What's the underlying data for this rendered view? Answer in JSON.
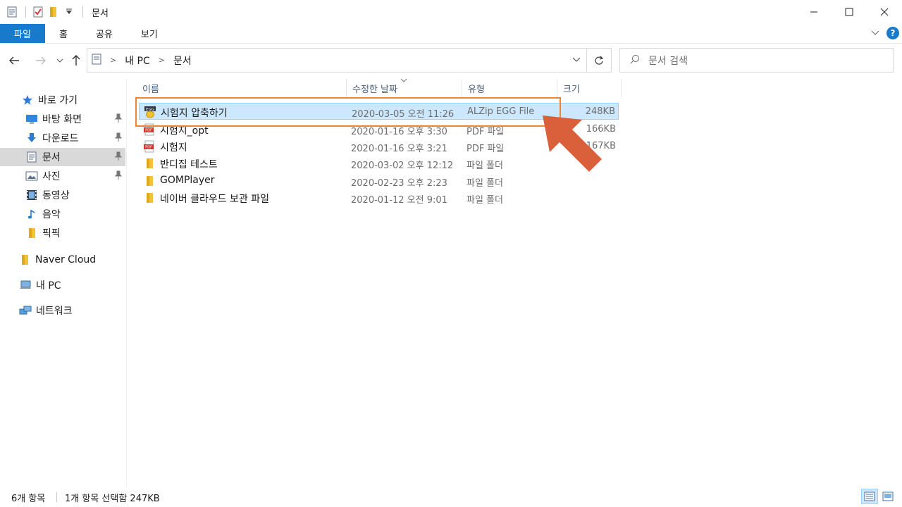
{
  "titlebar": {
    "title": "문서"
  },
  "ribbon": {
    "tabs": [
      "파일",
      "홈",
      "공유",
      "보기"
    ]
  },
  "address": {
    "crumbs": [
      "내 PC",
      "문서"
    ]
  },
  "search": {
    "placeholder": "문서 검색"
  },
  "sidebar": {
    "quick_access": "바로 가기",
    "pinned": [
      {
        "label": "바탕 화면",
        "icon": "desktop-icon"
      },
      {
        "label": "다운로드",
        "icon": "download-icon"
      },
      {
        "label": "문서",
        "icon": "documents-icon"
      },
      {
        "label": "사진",
        "icon": "pictures-icon"
      }
    ],
    "items": [
      {
        "label": "동영상",
        "icon": "videos-icon"
      },
      {
        "label": "음악",
        "icon": "music-icon"
      },
      {
        "label": "픽픽",
        "icon": "folder-icon"
      }
    ],
    "naver_cloud": "Naver Cloud",
    "this_pc": "내 PC",
    "network": "네트워크"
  },
  "columns": {
    "name": "이름",
    "date": "수정한 날짜",
    "type": "유형",
    "size": "크기"
  },
  "files": [
    {
      "name": "시험지 압축하기",
      "date": "2020-03-05 오전 11:26",
      "type": "ALZip EGG File",
      "size": "248KB",
      "icon": "egg-archive-icon"
    },
    {
      "name": "시험지_opt",
      "date": "2020-01-16 오후 3:30",
      "type": "PDF 파일",
      "size": "166KB",
      "icon": "pdf-icon"
    },
    {
      "name": "시험지",
      "date": "2020-01-16 오후 3:21",
      "type": "PDF 파일",
      "size": "167KB",
      "icon": "pdf-icon"
    },
    {
      "name": "반디집 테스트",
      "date": "2020-03-02 오후 12:12",
      "type": "파일 폴더",
      "size": "",
      "icon": "folder-icon"
    },
    {
      "name": "GOMPlayer",
      "date": "2020-02-23 오후 2:23",
      "type": "파일 폴더",
      "size": "",
      "icon": "folder-icon"
    },
    {
      "name": "네이버 클라우드 보관 파일",
      "date": "2020-01-12 오전 9:01",
      "type": "파일 폴더",
      "size": "",
      "icon": "folder-icon"
    }
  ],
  "status": {
    "count": "6개 항목",
    "selection": "1개 항목 선택함 247KB"
  },
  "colors": {
    "accent": "#1979ca",
    "selection": "#cce8ff",
    "highlight": "#e8873a",
    "arrow": "#d9603b"
  }
}
